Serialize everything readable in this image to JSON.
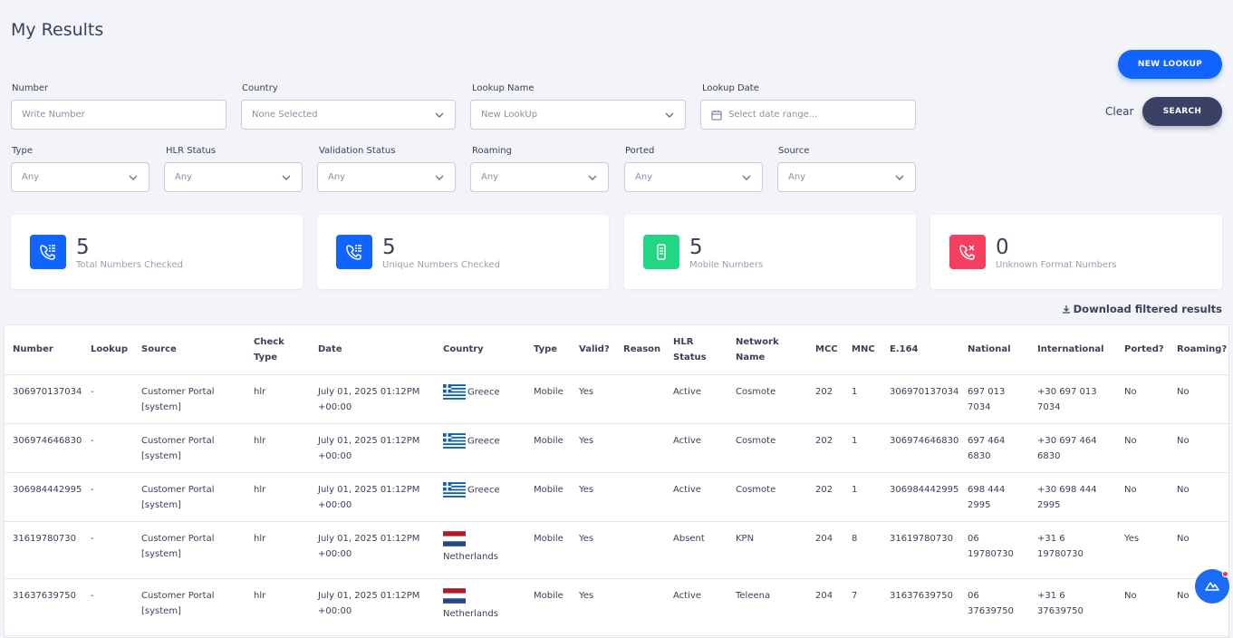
{
  "page": {
    "title": "My Results"
  },
  "actions": {
    "new_lookup": "NEW LOOKUP",
    "search": "SEARCH",
    "clear": "Clear"
  },
  "filters": {
    "number": {
      "label": "Number",
      "placeholder": "Write Number"
    },
    "country": {
      "label": "Country",
      "value": "None Selected"
    },
    "lookup_name": {
      "label": "Lookup Name",
      "value": "New LookUp"
    },
    "lookup_date": {
      "label": "Lookup Date",
      "placeholder": "Select date range..."
    },
    "type": {
      "label": "Type",
      "value": "Any"
    },
    "hlr_status": {
      "label": "HLR Status",
      "value": "Any"
    },
    "validation_status": {
      "label": "Validation Status",
      "value": "Any"
    },
    "roaming": {
      "label": "Roaming",
      "value": "Any"
    },
    "ported": {
      "label": "Ported",
      "value": "Any"
    },
    "source": {
      "label": "Source",
      "value": "Any"
    }
  },
  "stats": [
    {
      "value": "5",
      "label": "Total Numbers Checked",
      "icon": "phone-list-icon",
      "color": "#1164ff"
    },
    {
      "value": "5",
      "label": "Unique Numbers Checked",
      "icon": "phone-list-icon",
      "color": "#1164ff"
    },
    {
      "value": "5",
      "label": "Mobile Numbers",
      "icon": "mobile-icon",
      "color": "#22d684"
    },
    {
      "value": "0",
      "label": "Unknown Format Numbers",
      "icon": "phone-x-icon",
      "color": "#f43f5e"
    }
  ],
  "download_label": "Download filtered results",
  "table": {
    "columns": [
      "Number",
      "Lookup",
      "Source",
      "Check Type",
      "Date",
      "Country",
      "Type",
      "Valid?",
      "Reason",
      "HLR Status",
      "Network Name",
      "MCC",
      "MNC",
      "E.164",
      "National",
      "International",
      "Ported?",
      "Roaming?"
    ],
    "rows": [
      {
        "number": "306970137034",
        "lookup": "-",
        "source": "Customer Portal [system]",
        "check_type": "hlr",
        "date": "July 01, 2025 01:12PM +00:00",
        "country": "Greece",
        "type": "Mobile",
        "valid": "Yes",
        "reason": "",
        "hlr_status": "Active",
        "network": "Cosmote",
        "mcc": "202",
        "mnc": "1",
        "e164": "306970137034",
        "national": "697 013 7034",
        "international": "+30 697 013 7034",
        "ported": "No",
        "roaming": "No"
      },
      {
        "number": "306974646830",
        "lookup": "-",
        "source": "Customer Portal [system]",
        "check_type": "hlr",
        "date": "July 01, 2025 01:12PM +00:00",
        "country": "Greece",
        "type": "Mobile",
        "valid": "Yes",
        "reason": "",
        "hlr_status": "Active",
        "network": "Cosmote",
        "mcc": "202",
        "mnc": "1",
        "e164": "306974646830",
        "national": "697 464 6830",
        "international": "+30 697 464 6830",
        "ported": "No",
        "roaming": "No"
      },
      {
        "number": "306984442995",
        "lookup": "-",
        "source": "Customer Portal [system]",
        "check_type": "hlr",
        "date": "July 01, 2025 01:12PM +00:00",
        "country": "Greece",
        "type": "Mobile",
        "valid": "Yes",
        "reason": "",
        "hlr_status": "Active",
        "network": "Cosmote",
        "mcc": "202",
        "mnc": "1",
        "e164": "306984442995",
        "national": "698 444 2995",
        "international": "+30 698 444 2995",
        "ported": "No",
        "roaming": "No"
      },
      {
        "number": "31619780730",
        "lookup": "-",
        "source": "Customer Portal [system]",
        "check_type": "hlr",
        "date": "July 01, 2025 01:12PM +00:00",
        "country": "Netherlands",
        "type": "Mobile",
        "valid": "Yes",
        "reason": "",
        "hlr_status": "Absent",
        "network": "KPN",
        "mcc": "204",
        "mnc": "8",
        "e164": "31619780730",
        "national": "06 19780730",
        "international": "+31 6 19780730",
        "ported": "Yes",
        "roaming": "No"
      },
      {
        "number": "31637639750",
        "lookup": "-",
        "source": "Customer Portal [system]",
        "check_type": "hlr",
        "date": "July 01, 2025 01:12PM +00:00",
        "country": "Netherlands",
        "type": "Mobile",
        "valid": "Yes",
        "reason": "",
        "hlr_status": "Active",
        "network": "Teleena",
        "mcc": "204",
        "mnc": "7",
        "e164": "31637639750",
        "national": "06 37639750",
        "international": "+31 6 37639750",
        "ported": "No",
        "roaming": "No"
      }
    ]
  }
}
